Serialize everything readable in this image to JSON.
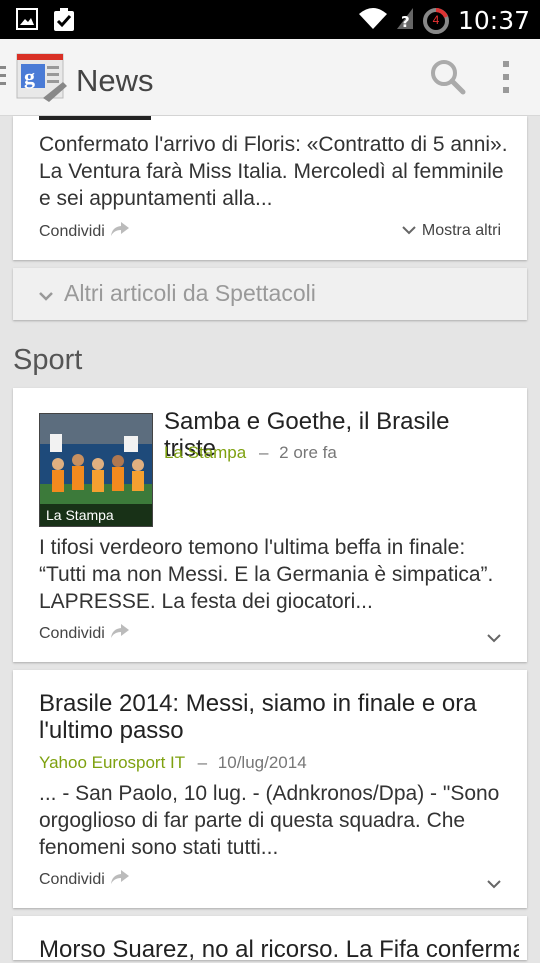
{
  "status_bar": {
    "time": "10:37",
    "notification_count": "4",
    "icons": [
      "image-icon",
      "clipboard-check-icon",
      "wifi-icon",
      "signal-unknown-icon",
      "battery-icon"
    ]
  },
  "app_bar": {
    "title": "News",
    "icons": [
      "news-logo-icon",
      "search-icon",
      "overflow-menu-icon"
    ]
  },
  "top_card": {
    "snippet": "Confermato l'arrivo di Floris: «Contratto di 5 anni». La Ventura farà Miss Italia. Mercoledì al femminile e sei appuntamenti alla...",
    "share_label": "Condividi",
    "more_label": "Mostra altri"
  },
  "more_articles": {
    "label": "Altri articoli da Spettacoli"
  },
  "section": {
    "title": "Sport"
  },
  "articles": [
    {
      "headline": "Samba e Goethe, il Brasile triste",
      "source": "La Stampa",
      "separator": "–",
      "time": "2 ore fa",
      "thumb_caption": "La Stampa",
      "snippet": "I tifosi verdeoro temono l'ultima beffa in finale: “Tutti ma non Messi. E la Germania è simpatica”. LAPRESSE. La festa dei giocatori...",
      "share_label": "Condividi"
    },
    {
      "headline": "Brasile 2014: Messi, siamo in finale e ora l'ultimo passo",
      "source": "Yahoo Eurosport IT",
      "separator": "–",
      "time": "10/lug/2014",
      "snippet": "... - San Paolo, 10 lug. - (Adnkronos/Dpa) - \"Sono orgoglioso di far parte di questa squadra. Che fenomeni sono stati tutti...",
      "share_label": "Condividi"
    },
    {
      "headline": "Morso Suarez, no al ricorso. La Fifa conferma lo"
    }
  ],
  "colors": {
    "source_green": "#7ea10f",
    "background": "#e5e5e5",
    "card": "#ffffff",
    "status_bar": "#000000"
  }
}
